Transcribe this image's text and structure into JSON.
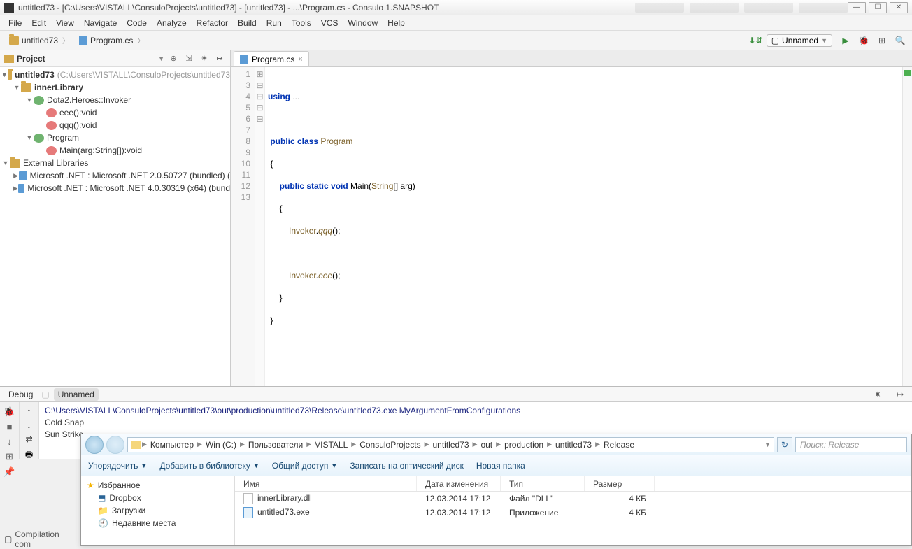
{
  "title_bar": {
    "title": "untitled73 - [C:\\Users\\VISTALL\\ConsuloProjects\\untitled73] - [untitled73] - ...\\Program.cs - Consulo 1.SNAPSHOT"
  },
  "menu": [
    "File",
    "Edit",
    "View",
    "Navigate",
    "Code",
    "Analyze",
    "Refactor",
    "Build",
    "Run",
    "Tools",
    "VCS",
    "Window",
    "Help"
  ],
  "breadcrumb": [
    {
      "icon": "folder",
      "label": "untitled73"
    },
    {
      "icon": "file",
      "label": "Program.cs"
    }
  ],
  "toolbar": {
    "run_config": "Unnamed"
  },
  "project_panel": {
    "title": "Project",
    "tree": {
      "root": {
        "label": "untitled73",
        "path": "(C:\\Users\\VISTALL\\ConsuloProjects\\untitled73"
      },
      "innerLibrary": {
        "label": "innerLibrary"
      },
      "invoker": {
        "label": "Dota2.Heroes::Invoker"
      },
      "eee": {
        "label": "eee():void"
      },
      "qqq": {
        "label": "qqq():void"
      },
      "program": {
        "label": "Program"
      },
      "main": {
        "label": "Main(arg:String[]):void"
      },
      "ext": {
        "label": "External Libraries"
      },
      "net2": {
        "label": "Microsoft .NET : Microsoft .NET 2.0.50727 (bundled) ("
      },
      "net4": {
        "label": "Microsoft .NET : Microsoft .NET 4.0.30319 (x64) (bund"
      }
    }
  },
  "editor": {
    "tab": "Program.cs",
    "lines": [
      "1",
      "3",
      "4",
      "5",
      "6",
      "7",
      "8",
      "9",
      "10",
      "11",
      "12",
      "13"
    ],
    "code": {
      "l1_kw": "using",
      "l1_dots": " ...",
      "l4_kw": "public class ",
      "l4_cls": "Program",
      "l5": "{",
      "l6_kw": "public static void ",
      "l6_m": "Main",
      "l6_p1": "(",
      "l6_str": "String",
      "l6_p2": "[] arg)",
      "l7": "{",
      "l8_c": "Invoker",
      "l8_d": ".",
      "l8_m": "qqq",
      "l8_e": "();",
      "l10_c": "Invoker",
      "l10_d": ".",
      "l10_m": "eee",
      "l10_e": "();",
      "l11": "}",
      "l12": "}"
    }
  },
  "debug": {
    "tab1": "Debug",
    "tab2": "Unnamed",
    "console_cmd": "C:\\Users\\VISTALL\\ConsuloProjects\\untitled73\\out\\production\\untitled73\\Release\\untitled73.exe MyArgumentFromConfigurations",
    "out1": "Cold Snap",
    "out2": "Sun Strike"
  },
  "status": {
    "text": "Compilation com"
  },
  "explorer": {
    "path": [
      "Компьютер",
      "Win (C:)",
      "Пользователи",
      "VISTALL",
      "ConsuloProjects",
      "untitled73",
      "out",
      "production",
      "untitled73",
      "Release"
    ],
    "search_placeholder": "Поиск: Release",
    "toolbar": [
      "Упорядочить",
      "Добавить в библиотеку",
      "Общий доступ",
      "Записать на оптический диск",
      "Новая папка"
    ],
    "side": {
      "fav": "Избранное",
      "dropbox": "Dropbox",
      "downloads": "Загрузки",
      "recent": "Недавние места"
    },
    "columns": [
      "Имя",
      "Дата изменения",
      "Тип",
      "Размер"
    ],
    "rows": [
      {
        "name": "innerLibrary.dll",
        "date": "12.03.2014 17:12",
        "type": "Файл \"DLL\"",
        "size": "4 КБ",
        "icon": "dll"
      },
      {
        "name": "untitled73.exe",
        "date": "12.03.2014 17:12",
        "type": "Приложение",
        "size": "4 КБ",
        "icon": "exe"
      }
    ]
  }
}
